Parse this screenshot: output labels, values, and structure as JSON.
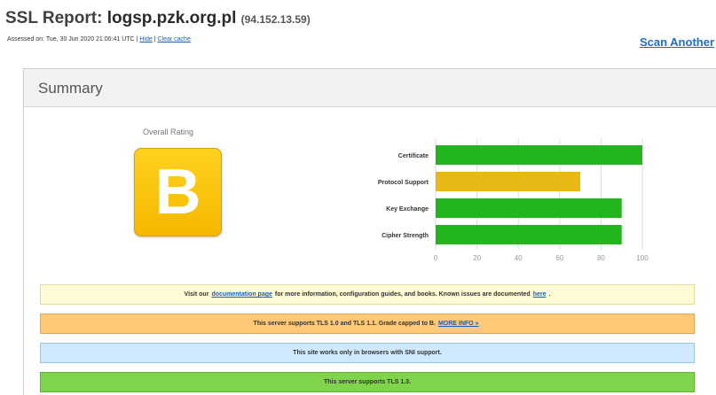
{
  "header": {
    "title_prefix": "SSL Report:",
    "hostname": "logsp.pzk.org.pl",
    "ip": "(94.152.13.59)",
    "assessed_label": "Assessed on:",
    "assessed_date": "Tue, 30 Jun 2020 21:00:41 UTC",
    "separator": "|",
    "hide_link": "Hide",
    "clear_cache_link": "Clear cache",
    "scan_another": "Scan Another"
  },
  "summary": {
    "title": "Summary",
    "overall_rating_label": "Overall Rating",
    "grade": "B",
    "grade_color": "#f5b800"
  },
  "chart_data": {
    "type": "bar",
    "orientation": "horizontal",
    "categories": [
      "Certificate",
      "Protocol Support",
      "Key Exchange",
      "Cipher Strength"
    ],
    "values": [
      100,
      70,
      90,
      90
    ],
    "colors": [
      "#22b51c",
      "#e8b814",
      "#22b51c",
      "#22b51c"
    ],
    "xlim": [
      0,
      100
    ],
    "xticks": [
      0,
      20,
      40,
      60,
      80,
      100
    ],
    "grid": true
  },
  "notices": {
    "doc": {
      "before": "Visit our",
      "link": "documentation page",
      "middle": "for more information, configuration guides, and books. Known issues are documented",
      "link2": "here",
      "after": "."
    },
    "tls": {
      "text": "This server supports TLS 1.0 and TLS 1.1. Grade capped to B.",
      "link": "MORE INFO »"
    },
    "sni": {
      "text": "This site works only in browsers with SNI support."
    },
    "tls13": {
      "text": "This server supports TLS 1.3."
    }
  }
}
